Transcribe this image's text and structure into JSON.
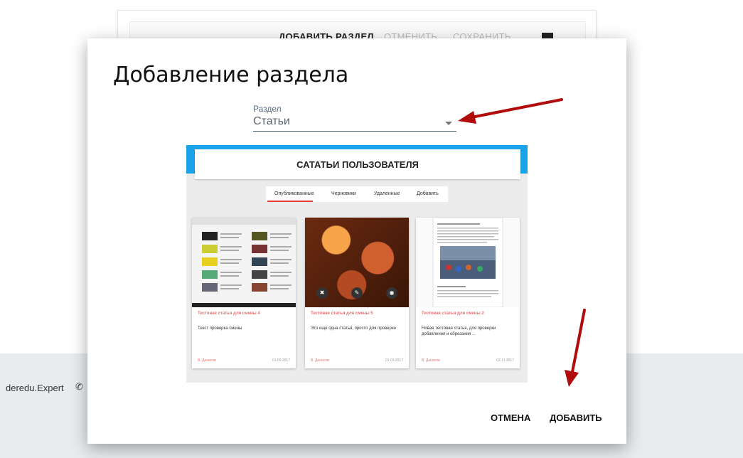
{
  "background": {
    "toolbar": {
      "add_section": "ДОБАВИТЬ РАЗДЕЛ",
      "cancel": "ОТМЕНИТЬ",
      "save": "СОХРАНИТЬ"
    },
    "footer": {
      "site": "deredu.Expert"
    }
  },
  "dialog": {
    "title": "Добавление раздела",
    "field_label": "Раздел",
    "field_value": "Статьи",
    "preview": {
      "header": "САТАТЬИ ПОЛЬЗОВАТЕЛЯ",
      "tabs": [
        "Опубликованные",
        "Черновики",
        "Удаленные",
        "Добавить"
      ],
      "cards": [
        {
          "title": "Тестовая статья для смены 4",
          "text": "Текст проверка смены",
          "author": "В. Денисов",
          "date": "01.03.2017"
        },
        {
          "title": "Тестовая статья для смены 5",
          "text": "Это еще одна статья, просто для проверки",
          "author": "В. Денисов",
          "date": "01.03.2017"
        },
        {
          "title": "Тестовая статья для смены 2",
          "text": "Новая тестовая статья, для проверки добавления и обрезания ...",
          "author": "В. Денисов",
          "date": "02.11.2017"
        }
      ]
    },
    "actions": {
      "cancel": "ОТМЕНА",
      "add": "ДОБАВИТЬ"
    }
  },
  "colors": {
    "accent_blue": "#1aa3e8",
    "accent_red": "#e53935",
    "arrow": "#b00c0c"
  }
}
